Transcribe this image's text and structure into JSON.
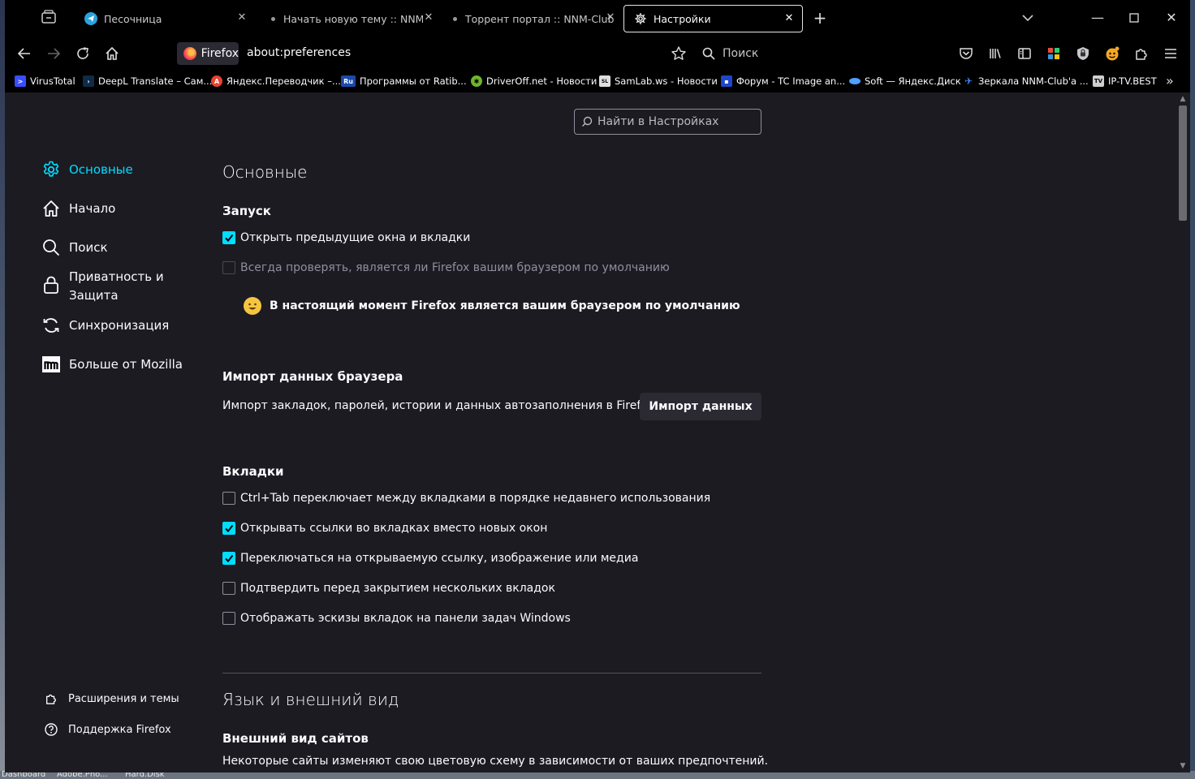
{
  "window": {
    "tabs": [
      {
        "title": "Песочница",
        "icon": "telegram-icon"
      },
      {
        "title": "Начать новую тему :: NNM-Club",
        "icon": "dot-icon"
      },
      {
        "title": "Торрент портал :: NNM-Club",
        "icon": "dot-icon"
      },
      {
        "title": "Настройки",
        "icon": "gear-icon",
        "active": true
      }
    ],
    "identity_label": "Firefox",
    "url": "about:preferences",
    "search_placeholder": "Поиск"
  },
  "bookmarks": [
    {
      "label": "VirusTotal",
      "icon": "virustotal-icon",
      "color": "#394eff"
    },
    {
      "label": "DeepL Translate – Сам...",
      "icon": "deepl-icon",
      "color": "#0f2b46"
    },
    {
      "label": "Яндекс.Переводчик –...",
      "icon": "yandex-translate-icon",
      "color": "#e8432f"
    },
    {
      "label": "Программы от Ratib...",
      "icon": "ru-icon",
      "color": "#1b4aa8"
    },
    {
      "label": "DriverOff.net - Новости",
      "icon": "gear-green-icon",
      "color": "#6fb52c"
    },
    {
      "label": "SamLab.ws - Новости",
      "icon": "samlab-icon",
      "color": "#dddddd"
    },
    {
      "label": "Форум - TC Image an...",
      "icon": "floppy-icon",
      "color": "#2046c8"
    },
    {
      "label": "Soft — Яндекс.Диск",
      "icon": "disk-icon",
      "color": "#4ea1ff"
    },
    {
      "label": "Зеркала NNM-Club'a ...",
      "icon": "nnm-icon",
      "color": "#3c8cff"
    },
    {
      "label": "IP-TV.BEST",
      "icon": "tv-icon",
      "color": "#cfcfcf"
    }
  ],
  "prefs": {
    "search_placeholder": "Найти в Настройках",
    "categories": [
      {
        "label": "Основные",
        "icon": "gear-icon",
        "selected": true
      },
      {
        "label": "Начало",
        "icon": "home-icon"
      },
      {
        "label": "Поиск",
        "icon": "search-icon"
      },
      {
        "label": "Приватность и Защита",
        "icon": "lock-icon"
      },
      {
        "label": "Синхронизация",
        "icon": "sync-icon"
      },
      {
        "label": "Больше от Mozilla",
        "icon": "mozilla-icon"
      }
    ],
    "footer_links": [
      {
        "label": "Расширения и темы",
        "icon": "puzzle-icon"
      },
      {
        "label": "Поддержка Firefox",
        "icon": "help-icon"
      }
    ],
    "general_title": "Основные",
    "startup": {
      "heading": "Запуск",
      "restore_session": {
        "label": "Открыть предыдущие окна и вкладки",
        "checked": true
      },
      "check_default": {
        "label": "Всегда проверять, является ли Firefox вашим браузером по умолчанию",
        "checked": false,
        "disabled": true
      },
      "is_default": "В настоящий момент Firefox является вашим браузером по умолчанию"
    },
    "import": {
      "heading": "Импорт данных браузера",
      "description": "Импорт закладок, паролей, истории и данных автозаполнения в Firefox.",
      "button": "Импорт данных"
    },
    "tabs": {
      "heading": "Вкладки",
      "options": [
        {
          "label": "Ctrl+Tab переключает между вкладками в порядке недавнего использования",
          "checked": false
        },
        {
          "label": "Открывать ссылки во вкладках вместо новых окон",
          "checked": true
        },
        {
          "label": "Переключаться на открываемую ссылку, изображение или медиа",
          "checked": true
        },
        {
          "label": "Подтвердить перед закрытием нескольких вкладок",
          "checked": false
        },
        {
          "label": "Отображать эскизы вкладок на панели задач Windows",
          "checked": false
        }
      ]
    },
    "language_title": "Язык и внешний вид",
    "appearance": {
      "heading": "Внешний вид сайтов",
      "description": "Некоторые сайты изменяют свою цветовую схему в зависимости от ваших предпочтений."
    }
  },
  "desktop": {
    "taskbar_labels": [
      "Dashboard",
      "Adobe.Pho...",
      "Hard.Disk"
    ]
  },
  "colors": {
    "accent": "#00ddff",
    "page_bg": "#1c1b22",
    "chrome_bg": "#000000",
    "button_bg": "#2b2a33"
  }
}
